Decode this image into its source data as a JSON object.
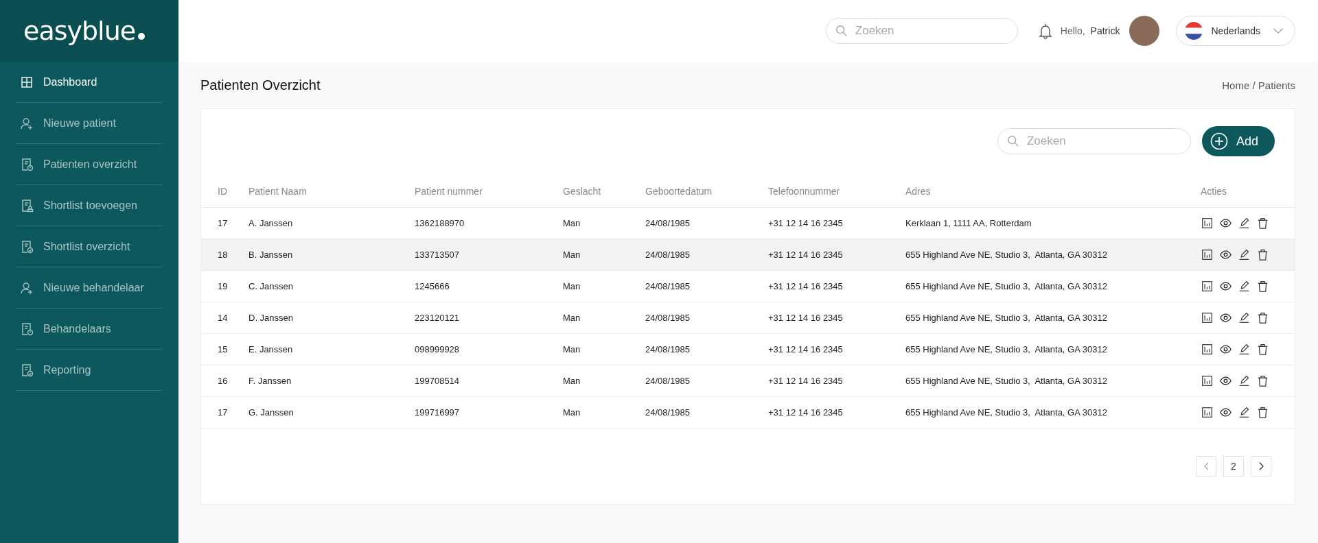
{
  "logo": {
    "text": "easyblue"
  },
  "sidebar": {
    "items": [
      {
        "label": "Dashboard",
        "kind": "grid",
        "selected": true
      },
      {
        "label": "Nieuwe patient",
        "kind": "user-add",
        "selected": false
      },
      {
        "label": "Patienten overzicht",
        "kind": "doc-alert",
        "selected": false
      },
      {
        "label": "Shortlist toevoegen",
        "kind": "doc-person",
        "selected": false
      },
      {
        "label": "Shortlist overzicht",
        "kind": "doc-check",
        "selected": false
      },
      {
        "label": "Nieuwe behandelaar",
        "kind": "user-add",
        "selected": false
      },
      {
        "label": "Behandelaars",
        "kind": "doc-alert",
        "selected": false
      },
      {
        "label": "Reporting",
        "kind": "doc-check",
        "selected": false
      }
    ]
  },
  "topbar": {
    "search": {
      "placeholder": "Zoeken"
    },
    "greeting": "Hello,",
    "user_name": "Patrick",
    "language": "Nederlands"
  },
  "page": {
    "title": "Patienten Overzicht",
    "breadcrumb": "Home / Patients"
  },
  "table_toolbar": {
    "search": {
      "placeholder": "Zoeken"
    },
    "add_button": "Add"
  },
  "table": {
    "columns": [
      "ID",
      "Patient Naam",
      "Patient nummer",
      "Geslacht",
      "Geboortedatum",
      "Telefoonnummer",
      "Adres",
      "Acties"
    ],
    "rows": [
      {
        "selected": false,
        "cells": [
          "17",
          "A. Janssen",
          "1362188970",
          "Man",
          "24/08/1985",
          "+31 12 14 16 2345",
          "Kerklaan 1, 1111 AA, Rotterdam"
        ]
      },
      {
        "selected": true,
        "cells": [
          "18",
          "B. Janssen",
          "133713507",
          "Man",
          "24/08/1985",
          "+31 12 14 16 2345",
          "655 Highland Ave NE, Studio 3,  Atlanta, GA 30312"
        ]
      },
      {
        "selected": false,
        "cells": [
          "19",
          "C. Janssen",
          "1245666",
          "Man",
          "24/08/1985",
          "+31 12 14 16 2345",
          "655 Highland Ave NE, Studio 3,  Atlanta, GA 30312"
        ]
      },
      {
        "selected": false,
        "cells": [
          "14",
          "D. Janssen",
          "223120121",
          "Man",
          "24/08/1985",
          "+31 12 14 16 2345",
          "655 Highland Ave NE, Studio 3,  Atlanta, GA 30312"
        ]
      },
      {
        "selected": false,
        "cells": [
          "15",
          "E. Janssen",
          "098999928",
          "Man",
          "24/08/1985",
          "+31 12 14 16 2345",
          "655 Highland Ave NE, Studio 3,  Atlanta, GA 30312"
        ]
      },
      {
        "selected": false,
        "cells": [
          "16",
          "F. Janssen",
          "199708514",
          "Man",
          "24/08/1985",
          "+31 12 14 16 2345",
          "655 Highland Ave NE, Studio 3,  Atlanta, GA 30312"
        ]
      },
      {
        "selected": false,
        "cells": [
          "17",
          "G. Janssen",
          "199716997",
          "Man",
          "24/08/1985",
          "+31 12 14 16 2345",
          "655 Highland Ave NE, Studio 3,  Atlanta, GA 30312"
        ]
      }
    ]
  },
  "pagination": {
    "previous_disabled": true,
    "next_disabled": false,
    "page": "2"
  }
}
